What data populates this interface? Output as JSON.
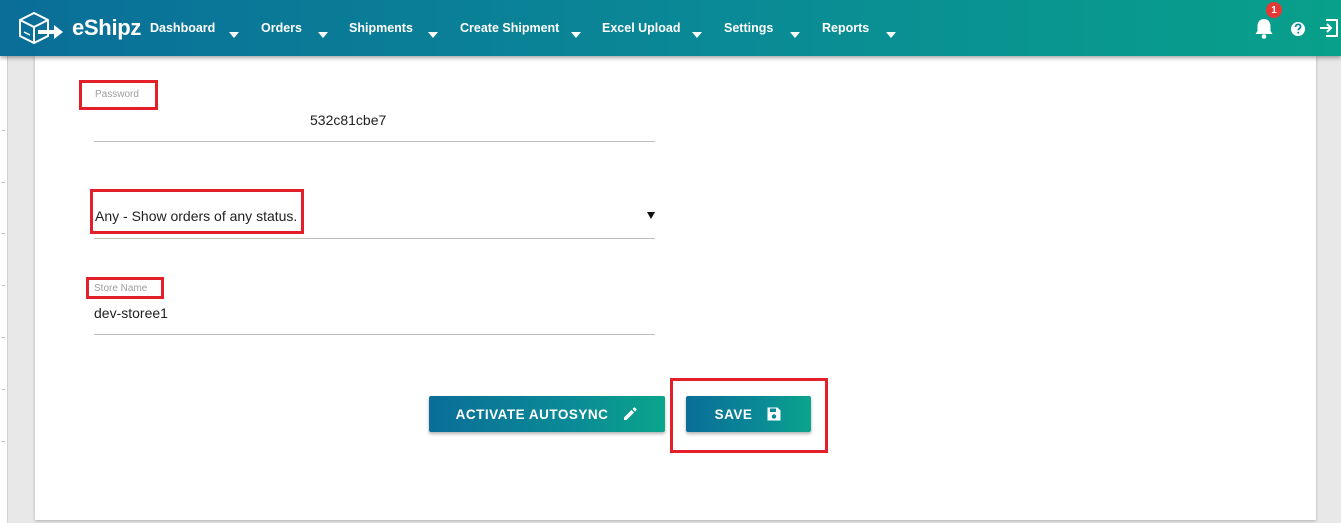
{
  "brand": {
    "name": "eShipz"
  },
  "nav": {
    "items": [
      {
        "label": "Dashboard"
      },
      {
        "label": "Orders"
      },
      {
        "label": "Shipments"
      },
      {
        "label": "Create Shipment"
      },
      {
        "label": "Excel Upload"
      },
      {
        "label": "Settings"
      },
      {
        "label": "Reports"
      }
    ],
    "notifications_count": "1"
  },
  "form": {
    "password": {
      "label": "Password",
      "value": "532c81cbe7"
    },
    "status_select": {
      "value": "Any - Show orders of any status."
    },
    "store_name": {
      "label": "Store Name",
      "value": "dev-storee1"
    }
  },
  "actions": {
    "autosync_label": "ACTIVATE AUTOSYNC",
    "save_label": "SAVE"
  },
  "colors": {
    "brand_start": "#0a6e98",
    "brand_end": "#08a08a",
    "highlight": "#e3202a",
    "badge": "#e53935"
  },
  "icons": {
    "logo": "box-arrow-logo-icon",
    "bell": "bell-icon",
    "help": "help-icon",
    "logout": "logout-icon",
    "pencil": "pencil-icon",
    "save": "floppy-disk-icon"
  }
}
